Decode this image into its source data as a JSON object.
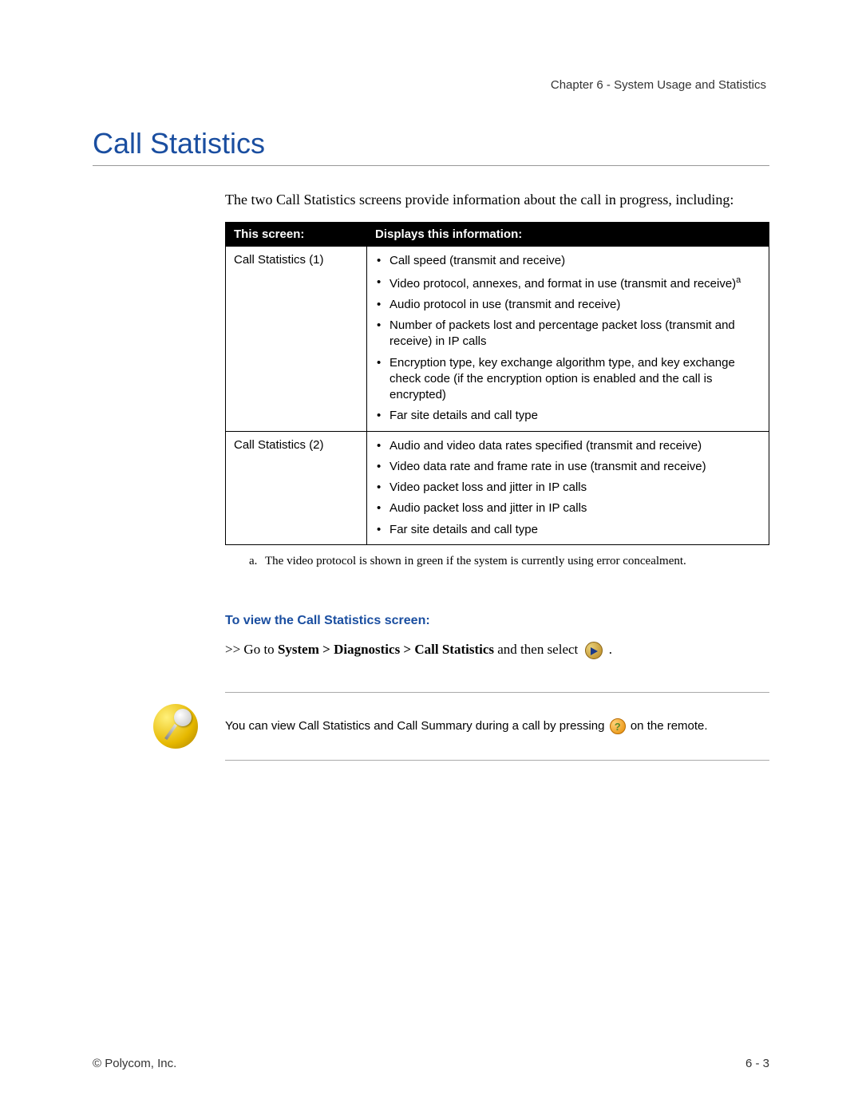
{
  "header": {
    "chapter": "Chapter 6 - System Usage and Statistics"
  },
  "title": "Call Statistics",
  "intro": "The two Call Statistics screens provide information about the call in progress, including:",
  "table": {
    "col1_header": "This screen:",
    "col2_header": "Displays this information:",
    "rows": [
      {
        "screen": "Call Statistics (1)",
        "items": [
          {
            "text": "Call speed (transmit and receive)"
          },
          {
            "text": "Video protocol, annexes, and format in use (transmit and receive)",
            "sup": "a"
          },
          {
            "text": "Audio protocol in use (transmit and receive)"
          },
          {
            "text": "Number of packets lost and percentage packet loss (transmit and receive) in IP calls"
          },
          {
            "text": "Encryption type, key exchange algorithm type, and key exchange check code (if the encryption option is enabled and the call is encrypted)"
          },
          {
            "text": "Far site details and call type"
          }
        ]
      },
      {
        "screen": "Call Statistics (2)",
        "items": [
          {
            "text": "Audio and video data rates specified (transmit and receive)"
          },
          {
            "text": "Video data rate and frame rate in use (transmit and receive)"
          },
          {
            "text": "Video packet loss and jitter in IP calls"
          },
          {
            "text": "Audio packet loss and jitter in IP calls"
          },
          {
            "text": "Far site details and call type"
          }
        ]
      }
    ]
  },
  "footnote": {
    "label": "a.",
    "text": "The video protocol is shown in green if the system is currently using error concealment."
  },
  "subheading": "To view the Call Statistics screen:",
  "nav": {
    "prefix": ">> Go to ",
    "path": "System > Diagnostics > Call Statistics",
    "suffix": " and then select ",
    "tail": " ."
  },
  "note": {
    "before": "You can view Call Statistics and Call Summary during a call by pressing ",
    "after": " on the remote."
  },
  "footer": {
    "copyright": "© Polycom, Inc.",
    "pagenum": "6 - 3"
  }
}
